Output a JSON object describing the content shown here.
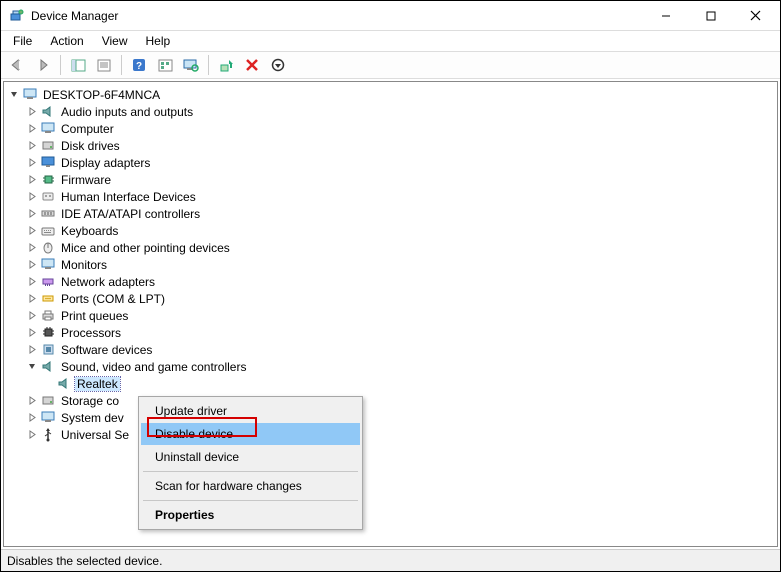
{
  "window": {
    "title": "Device Manager"
  },
  "menubar": [
    {
      "label": "File"
    },
    {
      "label": "Action"
    },
    {
      "label": "View"
    },
    {
      "label": "Help"
    }
  ],
  "tree": {
    "root": "DESKTOP-6F4MNCA",
    "categories": [
      "Audio inputs and outputs",
      "Computer",
      "Disk drives",
      "Display adapters",
      "Firmware",
      "Human Interface Devices",
      "IDE ATA/ATAPI controllers",
      "Keyboards",
      "Mice and other pointing devices",
      "Monitors",
      "Network adapters",
      "Ports (COM & LPT)",
      "Print queues",
      "Processors",
      "Software devices",
      "Sound, video and game controllers",
      "Storage co",
      "System dev",
      "Universal Se"
    ],
    "selected_device": "Realtek"
  },
  "context_menu": {
    "items": [
      {
        "label": "Update driver"
      },
      {
        "label": "Disable device",
        "highlight": true
      },
      {
        "label": "Uninstall device"
      },
      {
        "sep": true
      },
      {
        "label": "Scan for hardware changes"
      },
      {
        "sep": true
      },
      {
        "label": "Properties",
        "bold": true
      }
    ]
  },
  "statusbar": {
    "text": "Disables the selected device."
  }
}
